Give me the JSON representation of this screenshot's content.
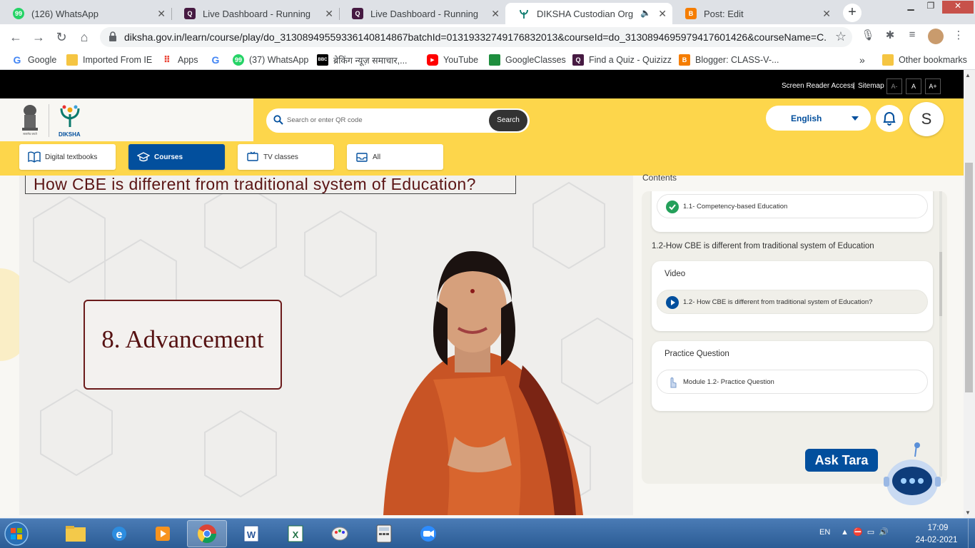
{
  "browser": {
    "tabs": [
      {
        "title": "(126) WhatsApp",
        "fav": "whatsapp-icon",
        "color": "#25d366"
      },
      {
        "title": "Live Dashboard - Running",
        "fav": "quizizz-icon",
        "color": "#461a42"
      },
      {
        "title": "Live Dashboard - Running",
        "fav": "quizizz-icon",
        "color": "#461a42"
      },
      {
        "title": "DIKSHA Custodian Org",
        "fav": "diksha-icon",
        "color": "#ffffff",
        "active": true
      },
      {
        "title": "Post: Edit",
        "fav": "blogger-icon",
        "color": "#f57d00"
      }
    ],
    "url": "diksha.gov.in/learn/course/play/do_31308949559336140814867batchId=01319332749176832013&courseId=do_3130894695979417601426&courseName=C...",
    "bookmarks": [
      {
        "label": "Google",
        "icon": "google-icon",
        "color": "#4285f4"
      },
      {
        "label": "Imported From IE",
        "icon": "folder-icon",
        "color": "#f5c542"
      },
      {
        "label": "Apps",
        "icon": "apps-icon",
        "color": "#ea4335"
      },
      {
        "label": "",
        "icon": "google-icon",
        "color": "#4285f4"
      },
      {
        "label": "(37) WhatsApp",
        "icon": "whatsapp-icon",
        "color": "#25d366"
      },
      {
        "label": "ब्रेकिंग न्यूज़ समाचार,...",
        "icon": "bbc-icon",
        "color": "#000000"
      },
      {
        "label": "YouTube",
        "icon": "youtube-icon",
        "color": "#ff0000"
      },
      {
        "label": "GoogleClasses",
        "icon": "classroom-icon",
        "color": "#1e8e3e"
      },
      {
        "label": "Find a Quiz - Quizizz",
        "icon": "quizizz-icon",
        "color": "#461a42"
      },
      {
        "label": "Blogger: CLASS-V-...",
        "icon": "blogger-icon",
        "color": "#f57d00"
      }
    ],
    "bookmarks_more": "»",
    "other_bookmarks": "Other bookmarks"
  },
  "site": {
    "top_links": {
      "screen_reader": "Screen Reader Access",
      "sitemap": "Sitemap",
      "sep": "|"
    },
    "font_buttons": [
      "A-",
      "A",
      "A+"
    ],
    "logo_label": "DIKSHA",
    "search_placeholder": "Search or enter QR code",
    "search_button": "Search",
    "language": "English",
    "avatar_initial": "S",
    "nav_tabs": [
      {
        "label": "Digital textbooks",
        "icon": "book-icon"
      },
      {
        "label": "Courses",
        "icon": "graduation-cap-icon",
        "active": true
      },
      {
        "label": "TV classes",
        "icon": "tv-icon"
      },
      {
        "label": "All",
        "icon": "inbox-icon"
      }
    ],
    "accent": "#024f9d",
    "yellow": "#fdd64b"
  },
  "video": {
    "title": "How CBE is different from traditional system of Education?",
    "slide_text": "8. Advancement"
  },
  "contents": {
    "heading": "Contents",
    "completed_item": "1.1- Competency-based Education",
    "section": "1.2-How CBE is different from traditional system of Education",
    "video_card": {
      "title": "Video",
      "item": "1.2- How CBE is different from traditional system of Education?"
    },
    "practice_card": {
      "title": "Practice Question",
      "item": "Module 1.2- Practice Question"
    }
  },
  "assistant": {
    "label": "Ask Tara"
  },
  "taskbar": {
    "apps": [
      "explorer-icon",
      "ie-icon",
      "media-player-icon",
      "chrome-icon",
      "word-icon",
      "excel-icon",
      "paint-icon",
      "calculator-icon",
      "zoom-icon"
    ],
    "lang": "EN",
    "time": "17:09",
    "date": "24-02-2021"
  }
}
